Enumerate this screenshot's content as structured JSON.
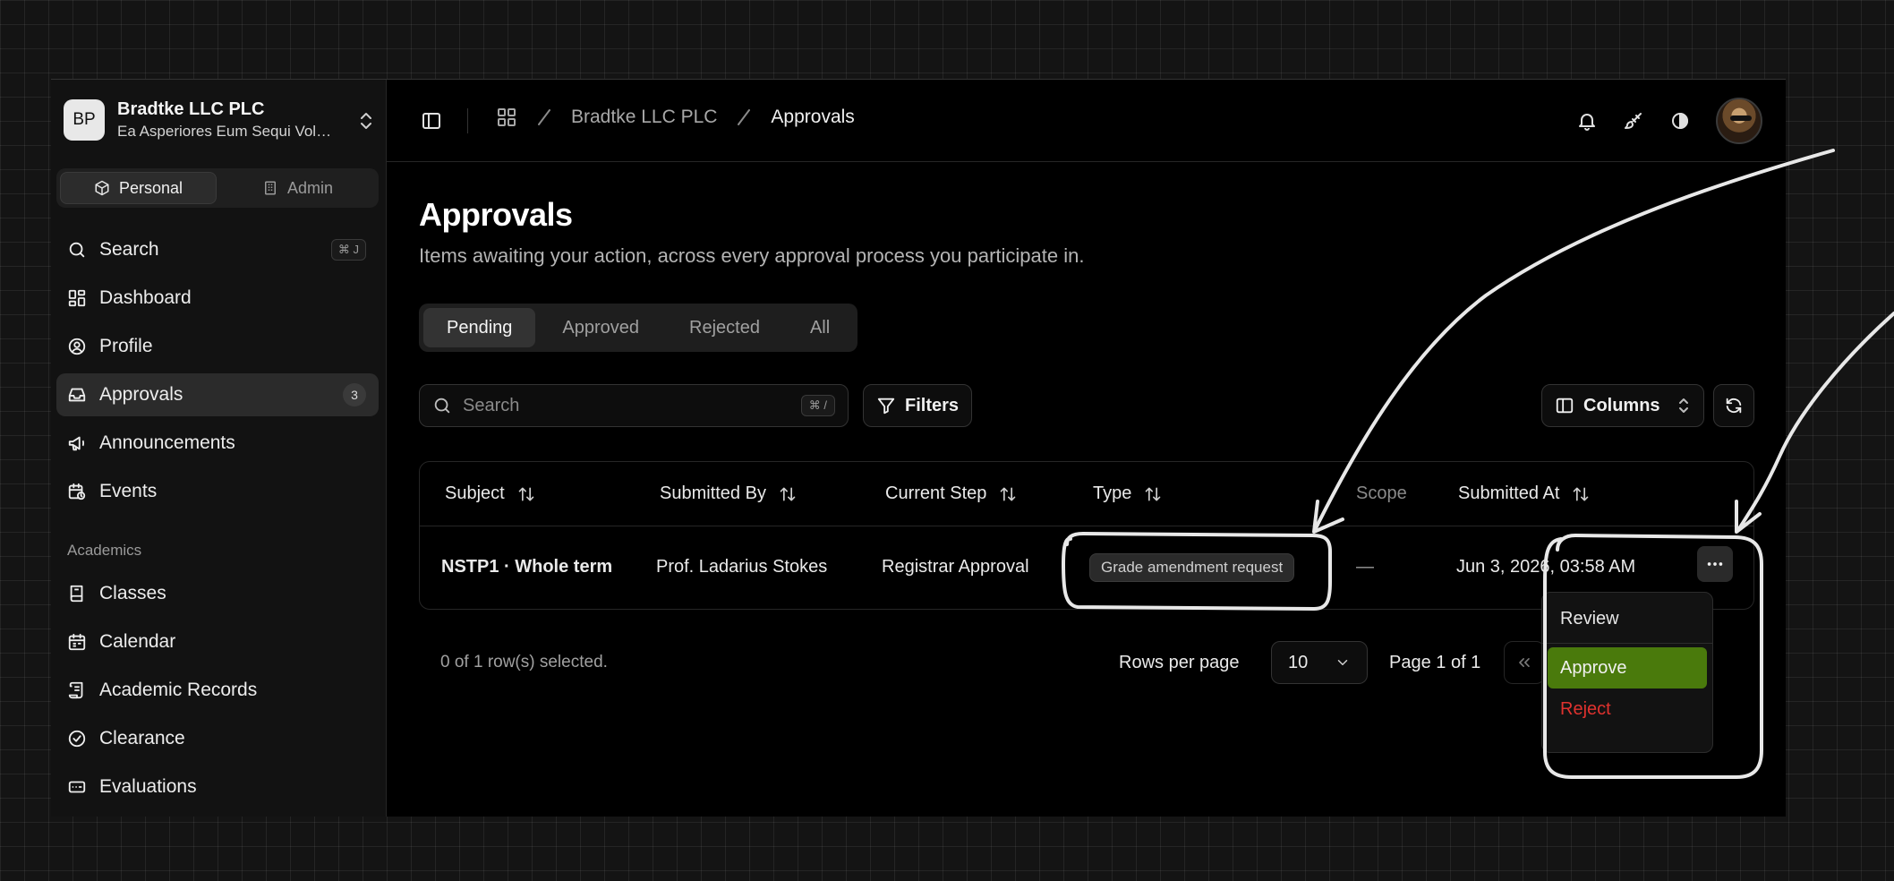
{
  "org": {
    "initials": "BP",
    "name": "Bradtke LLC PLC",
    "subtitle": "Ea Asperiores Eum Sequi Voluptas"
  },
  "modes": [
    {
      "label": "Personal",
      "icon": "box-icon",
      "active": true
    },
    {
      "label": "Admin",
      "icon": "building-icon",
      "active": false
    }
  ],
  "nav": {
    "search": {
      "label": "Search",
      "shortcut": "⌘ J"
    },
    "items": [
      {
        "label": "Dashboard",
        "icon": "dashboard-icon"
      },
      {
        "label": "Profile",
        "icon": "user-circle-icon"
      },
      {
        "label": "Approvals",
        "icon": "inbox-icon",
        "badge": "3",
        "active": true
      },
      {
        "label": "Announcements",
        "icon": "megaphone-icon"
      },
      {
        "label": "Events",
        "icon": "calendar-clock-icon"
      }
    ],
    "section_label": "Academics",
    "academics": [
      {
        "label": "Classes",
        "icon": "book-icon"
      },
      {
        "label": "Calendar",
        "icon": "calendar-icon"
      },
      {
        "label": "Academic Records",
        "icon": "scroll-icon"
      },
      {
        "label": "Clearance",
        "icon": "check-circle-icon"
      },
      {
        "label": "Evaluations",
        "icon": "card-icon"
      }
    ]
  },
  "header": {
    "breadcrumb": [
      "Bradtke LLC PLC",
      "Approvals"
    ]
  },
  "page": {
    "title": "Approvals",
    "subtitle": "Items awaiting your action, across every approval process you participate in."
  },
  "tabs": [
    {
      "label": "Pending",
      "active": true
    },
    {
      "label": "Approved",
      "active": false
    },
    {
      "label": "Rejected",
      "active": false
    },
    {
      "label": "All",
      "active": false
    }
  ],
  "toolbar": {
    "search_placeholder": "Search",
    "search_shortcut": "⌘ /",
    "filters_label": "Filters",
    "columns_label": "Columns"
  },
  "table": {
    "columns": [
      "Subject",
      "Submitted By",
      "Current Step",
      "Type",
      "Scope",
      "Submitted At"
    ],
    "rows": [
      {
        "subject": "NSTP1 · Whole term",
        "submitted_by": "Prof. Ladarius Stokes",
        "current_step": "Registrar Approval",
        "type": "Grade amendment request",
        "scope": "—",
        "submitted_at": "Jun 3, 2026, 03:58 AM"
      }
    ]
  },
  "footer": {
    "selected": "0 of 1 row(s) selected.",
    "rows_per_page_label": "Rows per page",
    "rows_per_page_value": "10",
    "page_info": "Page 1 of 1"
  },
  "row_menu": {
    "items": [
      "Review",
      "Approve",
      "Reject"
    ]
  },
  "colors": {
    "approve": "#4a7a0c",
    "reject": "#e0322e"
  }
}
